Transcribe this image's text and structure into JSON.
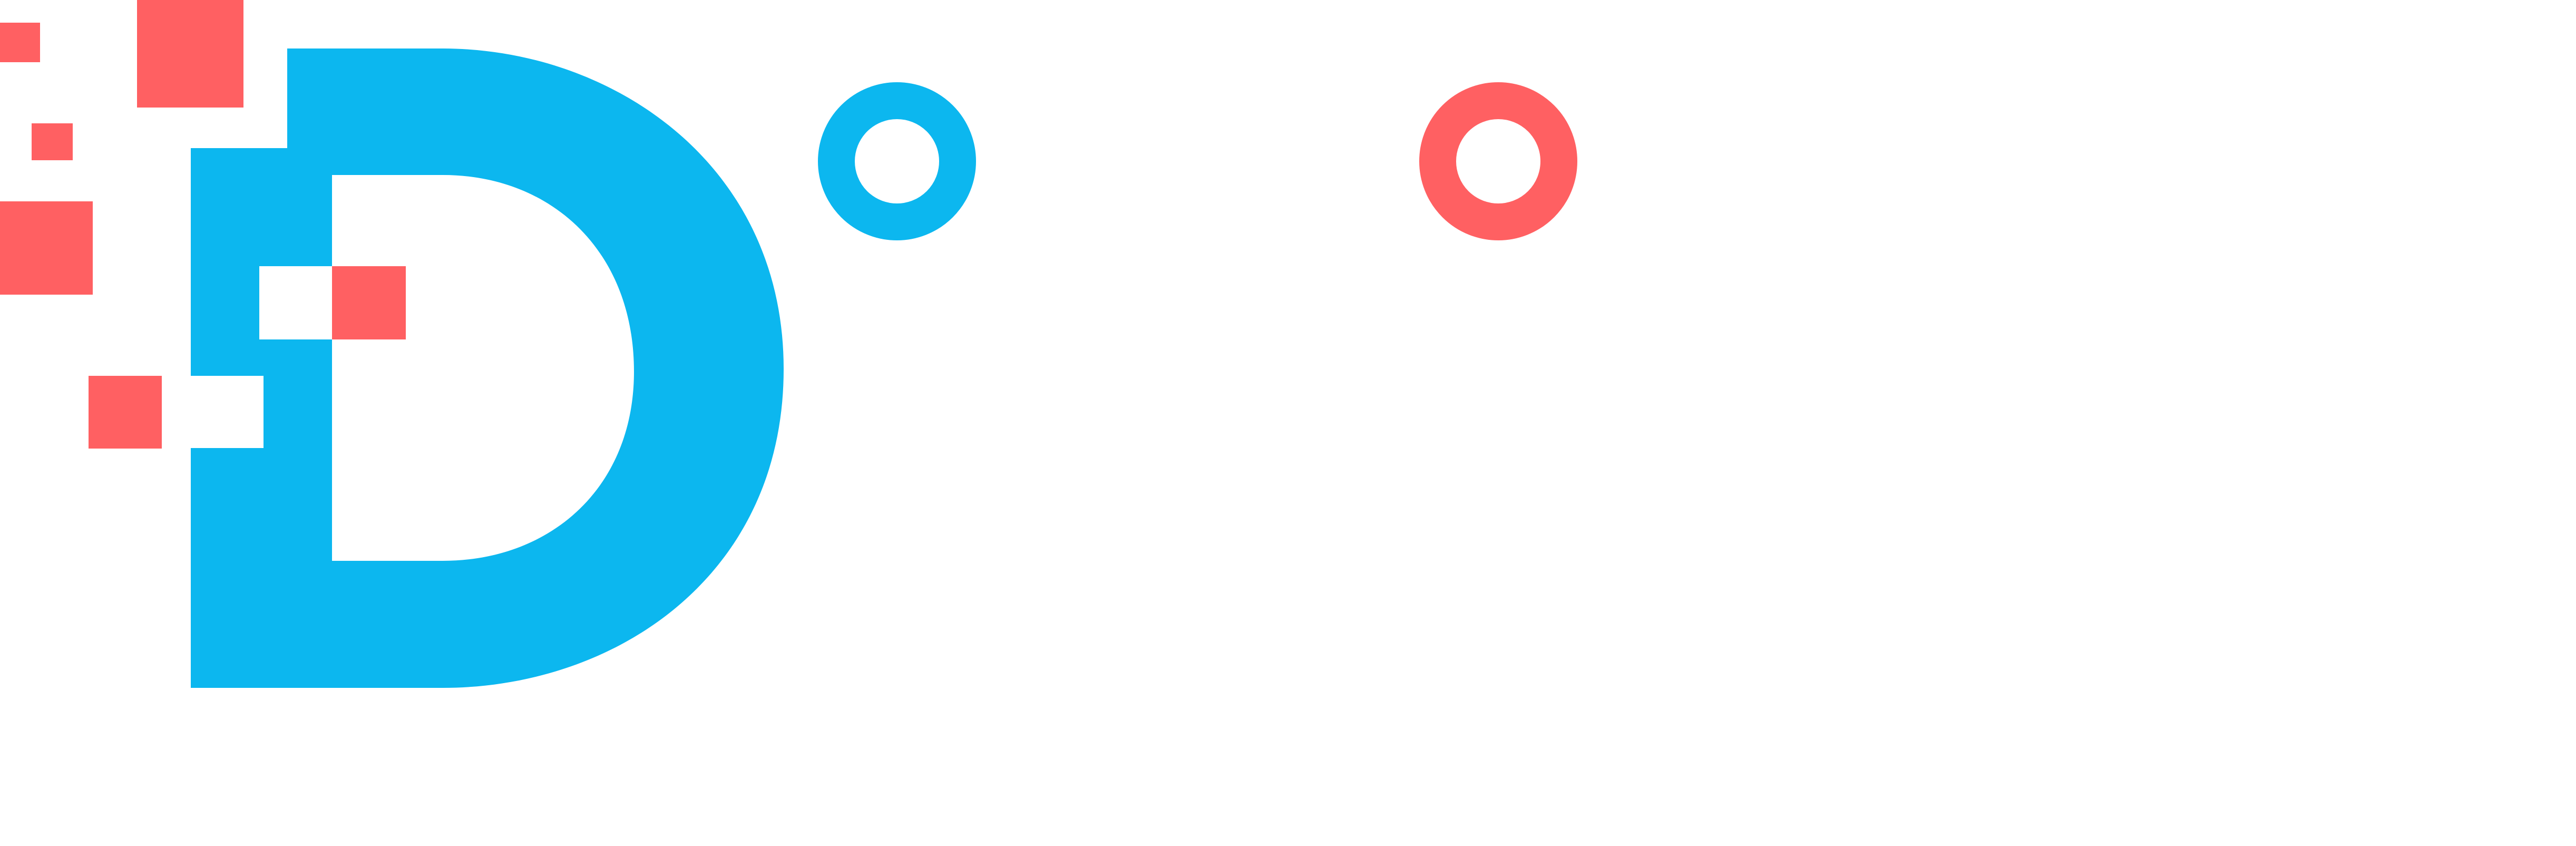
{
  "logo": {
    "colors": {
      "background": "#ffffff",
      "primary_blue": "#0cb7ef",
      "accent_coral": "#ff6062"
    },
    "icons": {
      "monogram": "letter-d-monogram",
      "pixel_squares": "pixel-square-icon",
      "rings": "ring-icon"
    }
  }
}
